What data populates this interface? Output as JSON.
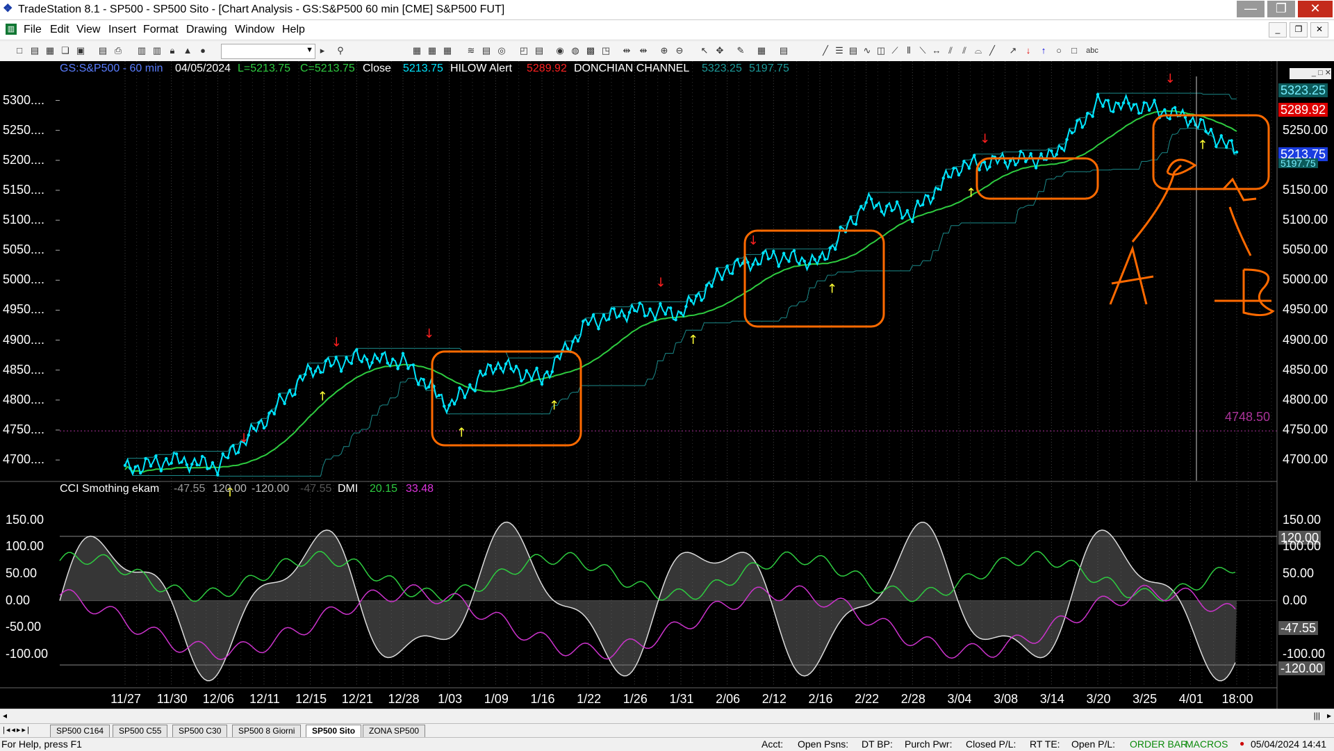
{
  "window": {
    "title": "TradeStation 8.1 - SP500 - SP500 Sito - [Chart Analysis - GS:S&P500  60 min  [CME] S&P500 FUT]",
    "minimize": "—",
    "maximize": "❐",
    "close": "✕"
  },
  "menu": [
    "File",
    "Edit",
    "View",
    "Insert",
    "Format",
    "Drawing",
    "Window",
    "Help"
  ],
  "toolbar": {
    "symbol_combo_value": ""
  },
  "chart_header": {
    "symbol": "GS:S&P500 - 60 min",
    "date": "04/05/2024",
    "low": "L=5213.75",
    "close_val": "C=5213.75",
    "close_label": "Close",
    "close_num": "5213.75",
    "hilow": "HILOW Alert",
    "hilow_num": "5289.92",
    "donchian": "DONCHIAN CHANNEL",
    "don_high": "5323.25",
    "don_low": "5197.75"
  },
  "indicator_header": {
    "name": "CCI Smothing ekam",
    "v1": "-47.55",
    "v2": "120.00",
    "v3": "-120.00",
    "v4": "-47.55",
    "dmi": "DMI",
    "dmi_plus": "20.15",
    "dmi_minus": "33.48"
  },
  "price_axis_labels": [
    "5300....",
    "5250....",
    "5200....",
    "5150....",
    "5100....",
    "5050....",
    "5000....",
    "4950....",
    "4900....",
    "4850....",
    "4800....",
    "4750....",
    "4700...."
  ],
  "right_axis_labels": [
    "5250.00",
    "5150.00",
    "5100.00",
    "5050.00",
    "5000.00",
    "4950.00",
    "4900.00",
    "4850.00",
    "4800.00",
    "4750.00",
    "4700.00"
  ],
  "right_tags": {
    "don_high": "5323.25",
    "hilow": "5289.92",
    "last": "5213.75",
    "don_low": "5197.75",
    "hline": "4748.50"
  },
  "ind_axis_labels": [
    "150.00",
    "100.00",
    "50.00",
    "0.00",
    "-50.00",
    "-100.00"
  ],
  "ind_right_labels": [
    "150.00",
    "100.00",
    "50.00",
    "0.00",
    "-100.00"
  ],
  "ind_right_tags": {
    "upper": "120.00",
    "value": "-47.55",
    "lower": "-120.00"
  },
  "date_axis": [
    "11/27",
    "11/30",
    "12/06",
    "12/11",
    "12/15",
    "12/21",
    "12/28",
    "1/03",
    "1/09",
    "1/16",
    "1/22",
    "1/26",
    "1/31",
    "2/06",
    "2/12",
    "2/16",
    "2/22",
    "2/28",
    "3/04",
    "3/08",
    "3/14",
    "3/20",
    "3/25",
    "4/01",
    "18:00"
  ],
  "tabs": [
    "SP500 C164",
    "SP500 C55",
    "SP500 C30",
    "SP500 8 Giorni",
    "SP500 Sito",
    "ZONA SP500"
  ],
  "active_tab": "SP500 Sito",
  "status": {
    "help": "For Help, press F1",
    "acct": "Acct:",
    "open_psns": "Open Psns:",
    "dt_bp": "DT BP:",
    "purch_pwr": "Purch Pwr:",
    "closed_pl": "Closed P/L:",
    "rt_te": "RT TE:",
    "open_pl": "Open P/L:",
    "order_bar": "ORDER BAR",
    "macros": "MACROS",
    "datetime": "05/04/2024 14:41"
  },
  "colors": {
    "price": "#00e5ff",
    "avg": "#2ecc40",
    "cci_fill": "#777777",
    "dmi_plus": "#2ecc40",
    "dmi_minus": "#cc33cc",
    "annotation": "#ff6a00",
    "red": "#ff2020",
    "yellow": "#ffff33"
  },
  "chart_data": {
    "type": "line",
    "price_series": [
      {
        "date": "11/27",
        "close": 4685
      },
      {
        "date": "11/30",
        "close": 4700
      },
      {
        "date": "12/06",
        "close": 4690
      },
      {
        "date": "12/11",
        "close": 4765
      },
      {
        "date": "12/15",
        "close": 4850
      },
      {
        "date": "12/21",
        "close": 4870
      },
      {
        "date": "12/28",
        "close": 4865
      },
      {
        "date": "1/03",
        "close": 4790
      },
      {
        "date": "1/09",
        "close": 4860
      },
      {
        "date": "1/16",
        "close": 4835
      },
      {
        "date": "1/22",
        "close": 4930
      },
      {
        "date": "1/26",
        "close": 4950
      },
      {
        "date": "1/31",
        "close": 4945
      },
      {
        "date": "2/06",
        "close": 5020
      },
      {
        "date": "2/12",
        "close": 5040
      },
      {
        "date": "2/16",
        "close": 5030
      },
      {
        "date": "2/22",
        "close": 5130
      },
      {
        "date": "2/28",
        "close": 5110
      },
      {
        "date": "3/04",
        "close": 5190
      },
      {
        "date": "3/08",
        "close": 5200
      },
      {
        "date": "3/14",
        "close": 5205
      },
      {
        "date": "3/20",
        "close": 5295
      },
      {
        "date": "3/25",
        "close": 5290
      },
      {
        "date": "4/01",
        "close": 5270
      },
      {
        "date": "18:00",
        "close": 5213.75
      }
    ],
    "y_range": [
      4670,
      5340
    ],
    "annotations": [
      "A",
      "B"
    ]
  }
}
